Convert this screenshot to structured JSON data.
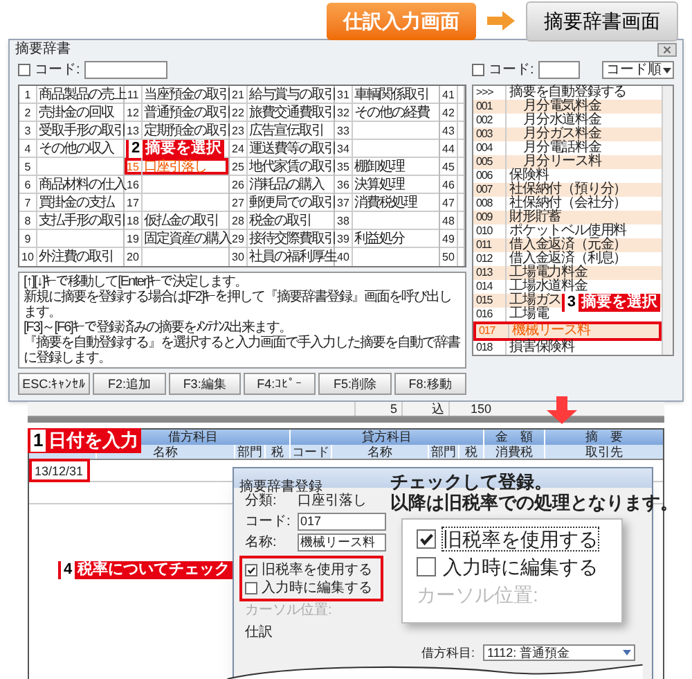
{
  "steps": {
    "from": "仕訳入力画面",
    "to": "摘要辞書画面"
  },
  "dictionary_window": {
    "title": "摘要辞書",
    "code_filter": {
      "label": "コード:",
      "checked": false
    },
    "grid": [
      [
        {
          "no": "1",
          "name": "商品製品の売上",
          "selected": false
        },
        {
          "no": "2",
          "name": "売掛金の回収",
          "selected": false
        },
        {
          "no": "3",
          "name": "受取手形の取引",
          "selected": false
        },
        {
          "no": "4",
          "name": "その他の収入",
          "selected": false
        },
        {
          "no": "5",
          "selected": false
        },
        {
          "no": "6",
          "name": "商品材料の仕入",
          "selected": false
        },
        {
          "no": "7",
          "name": "買掛金の支払",
          "selected": false
        },
        {
          "no": "8",
          "name": "支払手形の取引",
          "selected": false
        },
        {
          "no": "9",
          "selected": false
        },
        {
          "no": "10",
          "name": "外注費の取引",
          "selected": false
        }
      ],
      [
        {
          "no": "11",
          "name": "当座預金の取引",
          "selected": false
        },
        {
          "no": "12",
          "name": "普通預金の取引",
          "selected": false
        },
        {
          "no": "13",
          "name": "定期預金の取引",
          "selected": false
        },
        {
          "selected": false
        },
        {
          "no": "15",
          "name": "口座引落し",
          "selected": true
        },
        {
          "no": "16",
          "selected": false
        },
        {
          "no": "17",
          "selected": false
        },
        {
          "no": "18",
          "name": "仮払金の取引",
          "selected": false
        },
        {
          "no": "19",
          "name": "固定資産の購入",
          "selected": false
        },
        {
          "no": "20",
          "selected": false
        }
      ],
      [
        {
          "no": "21",
          "name": "給与賞与の取引",
          "selected": false
        },
        {
          "no": "22",
          "name": "旅費交通費取引",
          "selected": false
        },
        {
          "no": "23",
          "name": "広告宣伝取引",
          "selected": false
        },
        {
          "no": "24",
          "name": "運送費等の取引",
          "selected": false
        },
        {
          "no": "25",
          "name": "地代家賃の取引",
          "selected": false
        },
        {
          "no": "26",
          "name": "消耗品の購入",
          "selected": false
        },
        {
          "no": "27",
          "name": "郵便局での取引",
          "selected": false
        },
        {
          "no": "28",
          "name": "税金の取引",
          "selected": false
        },
        {
          "no": "29",
          "name": "接待交際費取引",
          "selected": false
        },
        {
          "no": "30",
          "name": "社員の福利厚生",
          "selected": false
        }
      ],
      [
        {
          "no": "31",
          "name": "車輌関係取引",
          "selected": false
        },
        {
          "no": "32",
          "name": "その他の経費",
          "selected": false
        },
        {
          "no": "33",
          "selected": false
        },
        {
          "no": "34",
          "selected": false
        },
        {
          "no": "35",
          "name": "棚卸処理",
          "selected": false
        },
        {
          "no": "36",
          "name": "決算処理",
          "selected": false
        },
        {
          "no": "37",
          "name": "消費税処理",
          "selected": false
        },
        {
          "no": "38",
          "selected": false
        },
        {
          "no": "39",
          "name": "利益処分",
          "selected": false
        },
        {
          "no": "40",
          "selected": false
        }
      ],
      [
        {
          "no": "41",
          "selected": false
        },
        {
          "no": "42",
          "selected": false
        },
        {
          "no": "43",
          "selected": false
        },
        {
          "no": "44",
          "selected": false
        },
        {
          "no": "45",
          "selected": false
        },
        {
          "no": "46",
          "selected": false
        },
        {
          "no": "47",
          "selected": false
        },
        {
          "no": "48",
          "selected": false
        },
        {
          "no": "49",
          "selected": false
        },
        {
          "no": "50",
          "selected": false
        }
      ]
    ],
    "instructions": [
      "[↑][↓]ｷｰで移動して[Enter]ｷｰで決定します。",
      "新規に摘要を登録する場合は[F2]ｷｰを押して『摘要辞書登録』画面を呼び出します。",
      "[F3]～[F6]ｷｰで登録済みの摘要をﾒﾝﾃﾅﾝｽ出来ます。",
      "『摘要を自動登録する』を選択すると入力画面で手入力した摘要を自動で辞書に登録します。"
    ],
    "buttons": [
      "ESC:ｷｬﾝｾﾙ",
      "F2:追加",
      "F3:編集",
      "F4:ｺﾋﾟｰ",
      "F5:削除",
      "F8:移動"
    ],
    "list_filter": {
      "label": "コード:",
      "checked": false
    },
    "sort": "コード順",
    "list": [
      {
        "code": ">>>",
        "name": "摘要を自動登録する",
        "indent": false,
        "selected": false
      },
      {
        "code": "001",
        "name": "月分電気料金",
        "indent": true,
        "selected": false
      },
      {
        "code": "002",
        "name": "月分水道料金",
        "indent": true,
        "selected": false
      },
      {
        "code": "003",
        "name": "月分ガス料金",
        "indent": true,
        "selected": false
      },
      {
        "code": "004",
        "name": "月分電話料金",
        "indent": true,
        "selected": false
      },
      {
        "code": "005",
        "name": "月分リース料",
        "indent": true,
        "selected": false
      },
      {
        "code": "006",
        "name": "保険料",
        "indent": false,
        "selected": false
      },
      {
        "code": "007",
        "name": "社保納付（預り分）",
        "indent": false,
        "selected": false
      },
      {
        "code": "008",
        "name": "社保納付（会社分）",
        "indent": false,
        "selected": false
      },
      {
        "code": "009",
        "name": "財形貯蓄",
        "indent": false,
        "selected": false
      },
      {
        "code": "010",
        "name": "ポケットベル使用料",
        "indent": false,
        "selected": false
      },
      {
        "code": "011",
        "name": "借入金返済（元金）",
        "indent": false,
        "selected": false
      },
      {
        "code": "012",
        "name": "借入金返済（利息）",
        "indent": false,
        "selected": false
      },
      {
        "code": "013",
        "name": "工場電力料金",
        "indent": false,
        "selected": false
      },
      {
        "code": "014",
        "name": "工場水道料金",
        "indent": false,
        "selected": false
      },
      {
        "code": "015",
        "name": "工場ガス",
        "indent": false,
        "selected": false
      },
      {
        "code": "016",
        "name": "工場電",
        "indent": false,
        "selected": false
      },
      {
        "code": "017",
        "name": "機械リース料",
        "indent": false,
        "selected": true
      },
      {
        "code": "018",
        "name": "損害保険料",
        "indent": false,
        "selected": false
      }
    ]
  },
  "journal_back_row": [
    "5",
    "込",
    "150"
  ],
  "journal": {
    "groups": [
      "借方科目",
      "貸方科目",
      "金　額",
      "摘　要"
    ],
    "columns": [
      "名称",
      "部門",
      "税",
      "コード",
      "名称",
      "部門",
      "税",
      "消費税",
      "取引先"
    ],
    "date": "13/12/31"
  },
  "register_dialog": {
    "title": "摘要辞書登録",
    "fields": [
      {
        "label": "分類:",
        "value": "口座引落し",
        "kind": "text"
      },
      {
        "label": "コード:",
        "value": "017",
        "kind": "input"
      },
      {
        "label": "名称:",
        "value": "機械リース料",
        "kind": "input"
      }
    ],
    "options": [
      {
        "label": "旧税率を使用する",
        "checked": true
      },
      {
        "label": "入力時に編集する",
        "checked": false
      }
    ],
    "cursor_label": "カーソル位置:",
    "section": "仕訳",
    "debit": {
      "label": "借方科目:",
      "value": "1112: 普通預金"
    }
  },
  "callouts": [
    {
      "no": "1",
      "text": "日付を入力"
    },
    {
      "no": "2",
      "text": "摘要を選択"
    },
    {
      "no": "3",
      "text": "摘要を選択"
    },
    {
      "no": "4",
      "text": "税率についてチェック"
    }
  ],
  "note": [
    "チェックして登録。",
    "以降は旧税率での処理となります。"
  ],
  "zoom": {
    "options": [
      {
        "label": "旧税率を使用する",
        "checked": true
      },
      {
        "label": "入力時に編集する",
        "checked": false
      }
    ],
    "cursor_label": "カーソル位置:"
  }
}
